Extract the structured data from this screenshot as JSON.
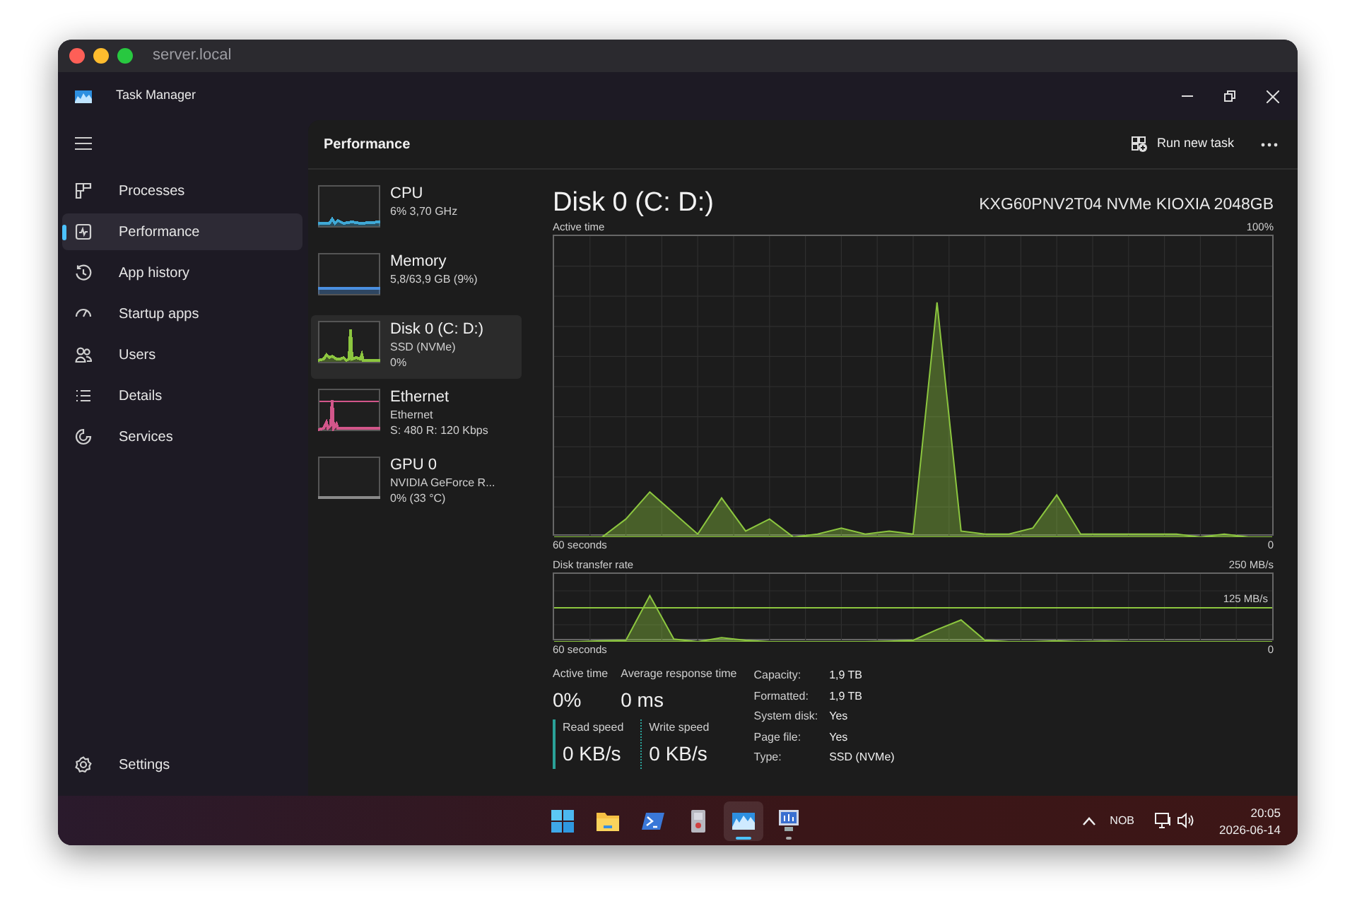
{
  "window": {
    "title": "server.local"
  },
  "app": {
    "title": "Task Manager"
  },
  "sidebar": {
    "items": [
      {
        "kind": "processes",
        "label": "Processes",
        "selected": false
      },
      {
        "kind": "performance",
        "label": "Performance",
        "selected": true
      },
      {
        "kind": "history",
        "label": "App history",
        "selected": false
      },
      {
        "kind": "startup",
        "label": "Startup apps",
        "selected": false
      },
      {
        "kind": "users",
        "label": "Users",
        "selected": false
      },
      {
        "kind": "details",
        "label": "Details",
        "selected": false
      },
      {
        "kind": "services",
        "label": "Services",
        "selected": false
      }
    ],
    "settings": {
      "label": "Settings"
    }
  },
  "header": {
    "title": "Performance",
    "run_new_task": "Run new task"
  },
  "devices": [
    {
      "kind": "cpu",
      "name": "CPU",
      "lines": [
        "6% 3,70 GHz"
      ],
      "color": "#3fa9d6",
      "selected": false
    },
    {
      "kind": "memory",
      "name": "Memory",
      "lines": [
        "5,8/63,9 GB (9%)"
      ],
      "color": "#4a8fe0",
      "selected": false
    },
    {
      "kind": "disk",
      "name": "Disk 0 (C: D:)",
      "lines": [
        "SSD (NVMe)",
        "0%"
      ],
      "color": "#8cc63f",
      "selected": true
    },
    {
      "kind": "ethernet",
      "name": "Ethernet",
      "lines": [
        "Ethernet",
        "S: 480 R: 120 Kbps"
      ],
      "color": "#d2568a",
      "selected": false
    },
    {
      "kind": "gpu",
      "name": "GPU 0",
      "lines": [
        "NVIDIA GeForce R...",
        "0% (33 °C)"
      ],
      "color": "#8a8a8a",
      "selected": false
    }
  ],
  "detail": {
    "title": "Disk 0 (C: D:)",
    "model": "KXG60PNV2T04 NVMe KIOXIA 2048GB",
    "charts": [
      {
        "kind": "active",
        "title": "Active time",
        "max_label": "100%",
        "span_label": "60 seconds",
        "min_label": "0"
      },
      {
        "kind": "transfer",
        "title": "Disk transfer rate",
        "max_label": "250 MB/s",
        "mid_label": "125 MB/s",
        "span_label": "60 seconds",
        "min_label": "0"
      }
    ],
    "stats": [
      {
        "label": "Active time",
        "value": "0%"
      },
      {
        "label": "Average response time",
        "value": "0 ms"
      }
    ],
    "speeds": [
      {
        "kind": "read",
        "label": "Read speed",
        "value": "0 KB/s"
      },
      {
        "kind": "write",
        "label": "Write speed",
        "value": "0 KB/s"
      }
    ],
    "properties": [
      {
        "label": "Capacity:",
        "value": "1,9 TB"
      },
      {
        "label": "Formatted:",
        "value": "1,9 TB"
      },
      {
        "label": "System disk:",
        "value": "Yes"
      },
      {
        "label": "Page file:",
        "value": "Yes"
      },
      {
        "label": "Type:",
        "value": "SSD (NVMe)"
      }
    ]
  },
  "taskbar": {
    "apps": [
      {
        "kind": "start",
        "selected": false,
        "running": false
      },
      {
        "kind": "folder",
        "selected": false,
        "running": false
      },
      {
        "kind": "terminal",
        "selected": false,
        "running": false
      },
      {
        "kind": "tool",
        "selected": false,
        "running": false
      },
      {
        "kind": "taskmanager",
        "selected": true,
        "running": true
      },
      {
        "kind": "remote",
        "selected": false,
        "running": true
      }
    ],
    "language": "NOB",
    "time": "20:05",
    "date": "2026-06-14"
  }
}
